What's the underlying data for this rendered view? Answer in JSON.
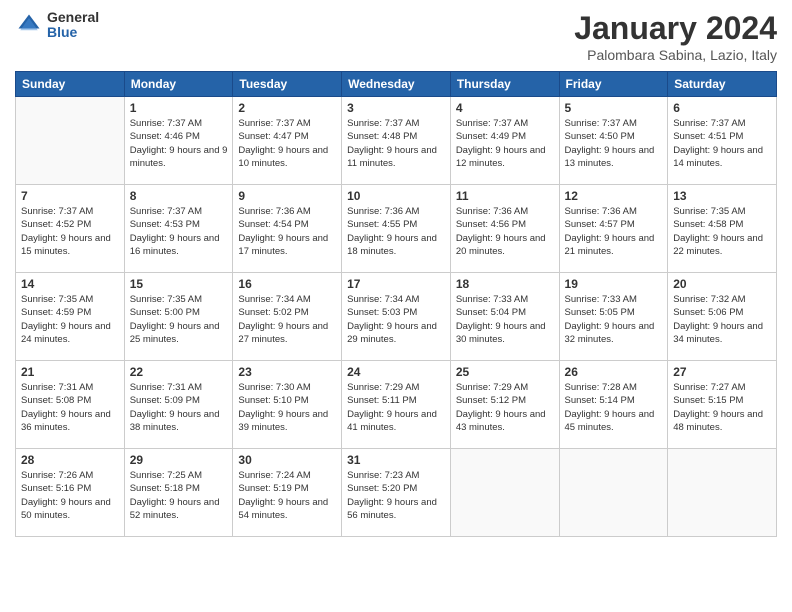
{
  "header": {
    "logo": {
      "general": "General",
      "blue": "Blue"
    },
    "title": "January 2024",
    "location": "Palombara Sabina, Lazio, Italy"
  },
  "days_of_week": [
    "Sunday",
    "Monday",
    "Tuesday",
    "Wednesday",
    "Thursday",
    "Friday",
    "Saturday"
  ],
  "weeks": [
    {
      "days": [
        {
          "num": "",
          "sunrise": "",
          "sunset": "",
          "daylight": "",
          "empty": true
        },
        {
          "num": "1",
          "sunrise": "Sunrise: 7:37 AM",
          "sunset": "Sunset: 4:46 PM",
          "daylight": "Daylight: 9 hours and 9 minutes."
        },
        {
          "num": "2",
          "sunrise": "Sunrise: 7:37 AM",
          "sunset": "Sunset: 4:47 PM",
          "daylight": "Daylight: 9 hours and 10 minutes."
        },
        {
          "num": "3",
          "sunrise": "Sunrise: 7:37 AM",
          "sunset": "Sunset: 4:48 PM",
          "daylight": "Daylight: 9 hours and 11 minutes."
        },
        {
          "num": "4",
          "sunrise": "Sunrise: 7:37 AM",
          "sunset": "Sunset: 4:49 PM",
          "daylight": "Daylight: 9 hours and 12 minutes."
        },
        {
          "num": "5",
          "sunrise": "Sunrise: 7:37 AM",
          "sunset": "Sunset: 4:50 PM",
          "daylight": "Daylight: 9 hours and 13 minutes."
        },
        {
          "num": "6",
          "sunrise": "Sunrise: 7:37 AM",
          "sunset": "Sunset: 4:51 PM",
          "daylight": "Daylight: 9 hours and 14 minutes."
        }
      ]
    },
    {
      "days": [
        {
          "num": "7",
          "sunrise": "Sunrise: 7:37 AM",
          "sunset": "Sunset: 4:52 PM",
          "daylight": "Daylight: 9 hours and 15 minutes."
        },
        {
          "num": "8",
          "sunrise": "Sunrise: 7:37 AM",
          "sunset": "Sunset: 4:53 PM",
          "daylight": "Daylight: 9 hours and 16 minutes."
        },
        {
          "num": "9",
          "sunrise": "Sunrise: 7:36 AM",
          "sunset": "Sunset: 4:54 PM",
          "daylight": "Daylight: 9 hours and 17 minutes."
        },
        {
          "num": "10",
          "sunrise": "Sunrise: 7:36 AM",
          "sunset": "Sunset: 4:55 PM",
          "daylight": "Daylight: 9 hours and 18 minutes."
        },
        {
          "num": "11",
          "sunrise": "Sunrise: 7:36 AM",
          "sunset": "Sunset: 4:56 PM",
          "daylight": "Daylight: 9 hours and 20 minutes."
        },
        {
          "num": "12",
          "sunrise": "Sunrise: 7:36 AM",
          "sunset": "Sunset: 4:57 PM",
          "daylight": "Daylight: 9 hours and 21 minutes."
        },
        {
          "num": "13",
          "sunrise": "Sunrise: 7:35 AM",
          "sunset": "Sunset: 4:58 PM",
          "daylight": "Daylight: 9 hours and 22 minutes."
        }
      ]
    },
    {
      "days": [
        {
          "num": "14",
          "sunrise": "Sunrise: 7:35 AM",
          "sunset": "Sunset: 4:59 PM",
          "daylight": "Daylight: 9 hours and 24 minutes."
        },
        {
          "num": "15",
          "sunrise": "Sunrise: 7:35 AM",
          "sunset": "Sunset: 5:00 PM",
          "daylight": "Daylight: 9 hours and 25 minutes."
        },
        {
          "num": "16",
          "sunrise": "Sunrise: 7:34 AM",
          "sunset": "Sunset: 5:02 PM",
          "daylight": "Daylight: 9 hours and 27 minutes."
        },
        {
          "num": "17",
          "sunrise": "Sunrise: 7:34 AM",
          "sunset": "Sunset: 5:03 PM",
          "daylight": "Daylight: 9 hours and 29 minutes."
        },
        {
          "num": "18",
          "sunrise": "Sunrise: 7:33 AM",
          "sunset": "Sunset: 5:04 PM",
          "daylight": "Daylight: 9 hours and 30 minutes."
        },
        {
          "num": "19",
          "sunrise": "Sunrise: 7:33 AM",
          "sunset": "Sunset: 5:05 PM",
          "daylight": "Daylight: 9 hours and 32 minutes."
        },
        {
          "num": "20",
          "sunrise": "Sunrise: 7:32 AM",
          "sunset": "Sunset: 5:06 PM",
          "daylight": "Daylight: 9 hours and 34 minutes."
        }
      ]
    },
    {
      "days": [
        {
          "num": "21",
          "sunrise": "Sunrise: 7:31 AM",
          "sunset": "Sunset: 5:08 PM",
          "daylight": "Daylight: 9 hours and 36 minutes."
        },
        {
          "num": "22",
          "sunrise": "Sunrise: 7:31 AM",
          "sunset": "Sunset: 5:09 PM",
          "daylight": "Daylight: 9 hours and 38 minutes."
        },
        {
          "num": "23",
          "sunrise": "Sunrise: 7:30 AM",
          "sunset": "Sunset: 5:10 PM",
          "daylight": "Daylight: 9 hours and 39 minutes."
        },
        {
          "num": "24",
          "sunrise": "Sunrise: 7:29 AM",
          "sunset": "Sunset: 5:11 PM",
          "daylight": "Daylight: 9 hours and 41 minutes."
        },
        {
          "num": "25",
          "sunrise": "Sunrise: 7:29 AM",
          "sunset": "Sunset: 5:12 PM",
          "daylight": "Daylight: 9 hours and 43 minutes."
        },
        {
          "num": "26",
          "sunrise": "Sunrise: 7:28 AM",
          "sunset": "Sunset: 5:14 PM",
          "daylight": "Daylight: 9 hours and 45 minutes."
        },
        {
          "num": "27",
          "sunrise": "Sunrise: 7:27 AM",
          "sunset": "Sunset: 5:15 PM",
          "daylight": "Daylight: 9 hours and 48 minutes."
        }
      ]
    },
    {
      "days": [
        {
          "num": "28",
          "sunrise": "Sunrise: 7:26 AM",
          "sunset": "Sunset: 5:16 PM",
          "daylight": "Daylight: 9 hours and 50 minutes."
        },
        {
          "num": "29",
          "sunrise": "Sunrise: 7:25 AM",
          "sunset": "Sunset: 5:18 PM",
          "daylight": "Daylight: 9 hours and 52 minutes."
        },
        {
          "num": "30",
          "sunrise": "Sunrise: 7:24 AM",
          "sunset": "Sunset: 5:19 PM",
          "daylight": "Daylight: 9 hours and 54 minutes."
        },
        {
          "num": "31",
          "sunrise": "Sunrise: 7:23 AM",
          "sunset": "Sunset: 5:20 PM",
          "daylight": "Daylight: 9 hours and 56 minutes."
        },
        {
          "num": "",
          "sunrise": "",
          "sunset": "",
          "daylight": "",
          "empty": true
        },
        {
          "num": "",
          "sunrise": "",
          "sunset": "",
          "daylight": "",
          "empty": true
        },
        {
          "num": "",
          "sunrise": "",
          "sunset": "",
          "daylight": "",
          "empty": true
        }
      ]
    }
  ]
}
